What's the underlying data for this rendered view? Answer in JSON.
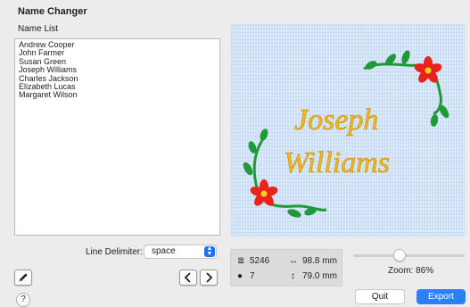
{
  "window": {
    "title": "Name Changer"
  },
  "name_list": {
    "label": "Name List",
    "names": [
      "Andrew Cooper",
      "John Farmer",
      "Susan Green",
      "Joseph Williams",
      "Charles Jackson",
      "Elizabeth Lucas",
      "Margaret Wilson"
    ]
  },
  "delimiter": {
    "label": "Line Delimiter:",
    "value": "space"
  },
  "preview": {
    "line1": "Joseph",
    "line2": "Williams",
    "text_color": "#f0b81a",
    "flower_color": "#e8231c",
    "leaf_color": "#1f9a36"
  },
  "stats": {
    "stitches": "5246",
    "width": "98.8 mm",
    "colors": "7",
    "height": "79.0 mm"
  },
  "zoom": {
    "label": "Zoom: 86%",
    "level_percent": 86
  },
  "buttons": {
    "quit": "Quit",
    "export": "Export",
    "help": "?"
  },
  "icons": {
    "edit": "pencil-icon",
    "prev": "chevron-left-icon",
    "next": "chevron-right-icon",
    "stitches": "stitch-count-icon",
    "colors": "palette-icon",
    "width": "width-arrow-icon",
    "height": "height-arrow-icon"
  }
}
